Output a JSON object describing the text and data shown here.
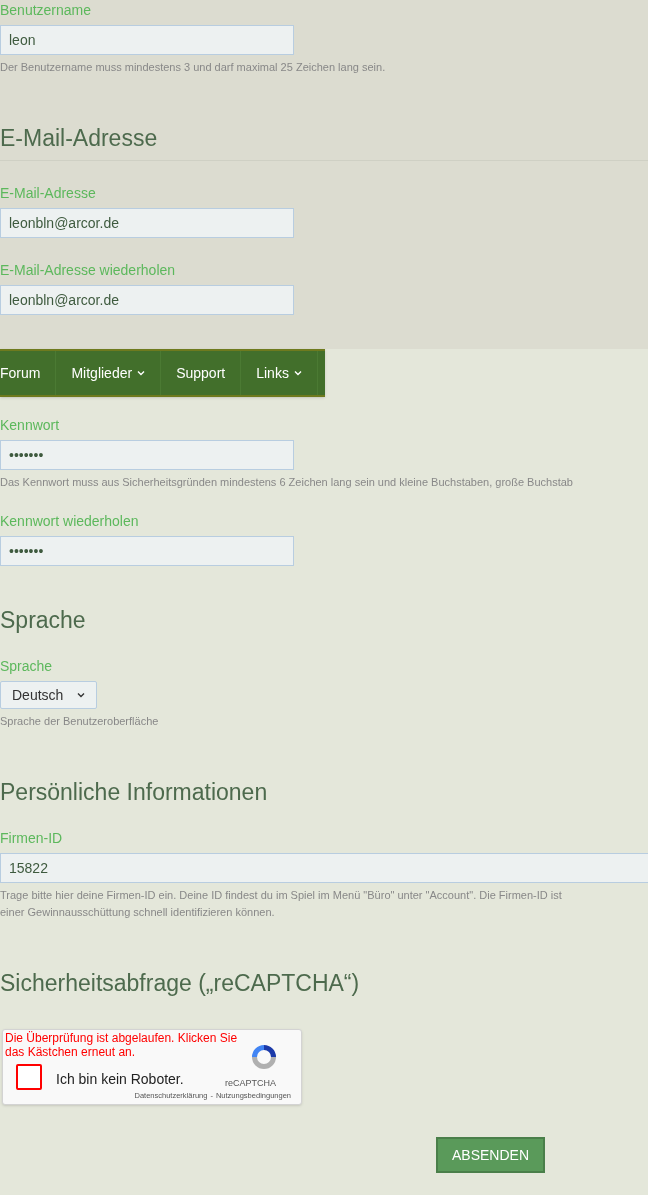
{
  "username": {
    "label": "Benutzername",
    "value": "leon",
    "hint": "Der Benutzername muss mindestens 3 und darf maximal 25 Zeichen lang sein."
  },
  "email_section": {
    "heading": "E-Mail-Adresse",
    "fields": [
      {
        "label": "E-Mail-Adresse",
        "value": "leonbln@arcor.de"
      },
      {
        "label": "E-Mail-Adresse wiederholen",
        "value": "leonbln@arcor.de"
      }
    ]
  },
  "nav": {
    "items": [
      {
        "label": "Forum",
        "has_menu": false
      },
      {
        "label": "Mitglieder",
        "has_menu": true
      },
      {
        "label": "Support",
        "has_menu": false
      },
      {
        "label": "Links",
        "has_menu": true
      }
    ]
  },
  "password_section": {
    "fields": [
      {
        "label": "Kennwort",
        "value": "•••••••",
        "hint": "Das Kennwort muss aus Sicherheitsgründen mindestens 6 Zeichen lang sein und kleine Buchstaben, große Buchstab"
      },
      {
        "label": "Kennwort wiederholen",
        "value": "•••••••"
      }
    ]
  },
  "language_section": {
    "heading": "Sprache",
    "label": "Sprache",
    "value": "Deutsch",
    "hint": "Sprache der Benutzeroberfläche"
  },
  "personal_section": {
    "heading": "Persönliche Informationen",
    "label": "Firmen-ID",
    "value": "15822",
    "hint_lines": [
      "Trage bitte hier deine Firmen-ID ein. Deine ID findest du im Spiel im Menü \"Büro\" unter \"Account\". Die Firmen-ID ist",
      "einer Gewinnausschüttung schnell identifizieren können."
    ]
  },
  "captcha_section": {
    "heading": "Sicherheitsabfrage („reCAPTCHA“)",
    "error": "Die Überprüfung ist abgelaufen. Klicken Sie das Kästchen erneut an.",
    "checkbox_label": "Ich bin kein Roboter.",
    "checked": false,
    "brand": "reCAPTCHA",
    "links": [
      "Datenschutzerklärung",
      "-",
      "Nutzungsbedingungen"
    ]
  },
  "submit": {
    "label": "ABSENDEN"
  }
}
